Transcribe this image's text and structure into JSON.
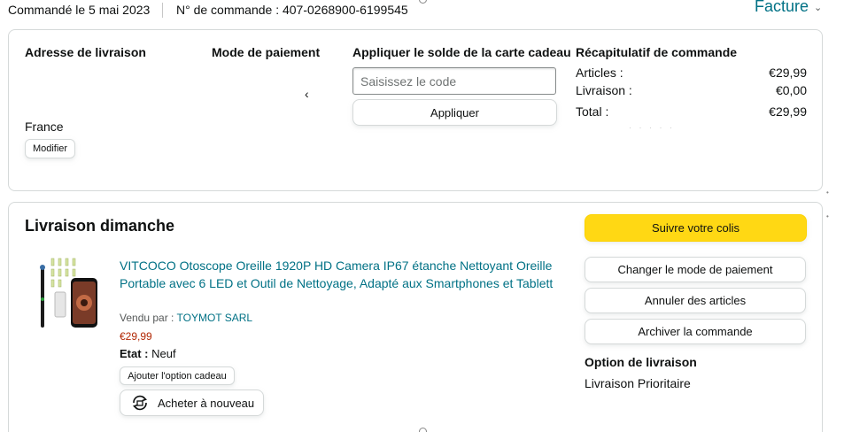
{
  "header": {
    "order_date": "Commandé le 5 mai 2023",
    "order_number": "N° de commande : 407-0268900-6199545",
    "invoice_label": "Facture",
    "invoice_icon": "chevron-down-icon"
  },
  "summary": {
    "address_title": "Adresse de livraison",
    "address_country": "France",
    "modify_label": "Modifier",
    "payment_title": "Mode de paiement",
    "payment_icon": "chevron-left-icon",
    "gift_title": "Appliquer le solde de la carte cadeau",
    "gift_placeholder": "Saisissez le code",
    "gift_apply_label": "Appliquer",
    "recap_title": "Récapitulatif de commande",
    "recap": {
      "items_label": "Articles :",
      "items_value": "€29,99",
      "delivery_label": "Livraison :",
      "delivery_value": "€0,00",
      "total_label": "Total :",
      "total_value": "€29,99"
    }
  },
  "shipment": {
    "title": "Livraison dimanche",
    "product": {
      "image_icon": "otoscope-product-image",
      "title": "VITCOCO Otoscope Oreille 1920P HD Camera IP67 étanche Nettoyant Oreille Portable avec 6 LED et Outil de Nettoyage, Adapté aux Smartphones et Tablett",
      "sold_by_label": "Vendu par :",
      "seller": "TOYMOT SARL",
      "price": "€29,99",
      "condition_label": "Etat :",
      "condition_value": "Neuf",
      "gift_option_label": "Ajouter l'option cadeau",
      "buy_again_label": "Acheter à nouveau",
      "buy_again_icon": "buy-again-icon"
    },
    "actions": {
      "track_label": "Suivre votre colis",
      "change_payment_label": "Changer le mode de paiement",
      "cancel_label": "Annuler des articles",
      "archive_label": "Archiver la commande"
    },
    "delivery_option_title": "Option de livraison",
    "delivery_option_value": "Livraison Prioritaire"
  },
  "colors": {
    "link": "#007185",
    "price": "#b12704",
    "track_button": "#ffd814",
    "border": "#d5d9d9"
  }
}
